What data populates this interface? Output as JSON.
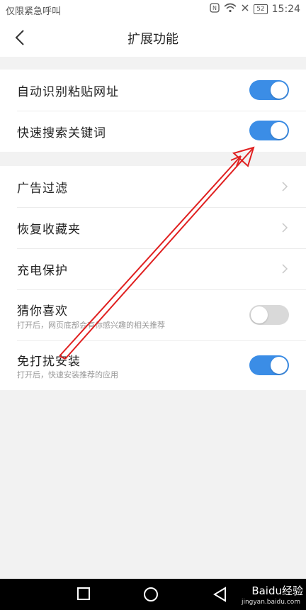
{
  "status": {
    "carrier": "仅限紧急呼叫",
    "battery": "52",
    "time": "15:24"
  },
  "header": {
    "title": "扩展功能"
  },
  "section1": [
    {
      "label": "自动识别粘贴网址",
      "toggle": "on"
    },
    {
      "label": "快速搜索关键词",
      "toggle": "on"
    }
  ],
  "section2": [
    {
      "label": "广告过滤"
    },
    {
      "label": "恢复收藏夹"
    },
    {
      "label": "充电保护"
    },
    {
      "label": "猜你喜欢",
      "sub": "打开后，网页底部会有你感兴趣的相关推荐",
      "toggle": "off"
    },
    {
      "label": "免打扰安装",
      "sub": "打开后，快速安装推荐的应用",
      "toggle": "on"
    }
  ],
  "watermark": {
    "brand": "Baidu经验",
    "url": "jingyan.baidu.com"
  },
  "colors": {
    "accent": "#3b8de6",
    "annotation": "#e02020"
  }
}
